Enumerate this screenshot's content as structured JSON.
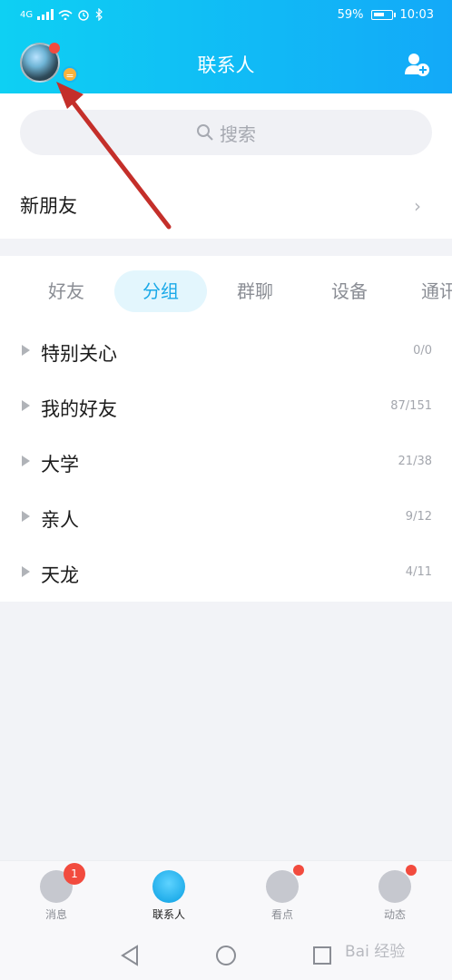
{
  "status_bar": {
    "signal": "4G",
    "battery_percent": "59%",
    "time": "10:03"
  },
  "header": {
    "title": "联系人",
    "avatar_badge": "="
  },
  "search": {
    "placeholder": "搜索"
  },
  "new_friends": {
    "label": "新朋友"
  },
  "tabs": [
    {
      "label": "好友",
      "active": false
    },
    {
      "label": "分组",
      "active": true
    },
    {
      "label": "群聊",
      "active": false
    },
    {
      "label": "设备",
      "active": false
    },
    {
      "label": "通讯",
      "active": false
    }
  ],
  "groups": [
    {
      "name": "特别关心",
      "count": "0/0"
    },
    {
      "name": "我的好友",
      "count": "87/151"
    },
    {
      "name": "大学",
      "count": "21/38"
    },
    {
      "name": "亲人",
      "count": "9/12"
    },
    {
      "name": "天龙",
      "count": "4/11"
    }
  ],
  "bottom_nav": [
    {
      "label": "消息",
      "badge": "1",
      "icon": "message-icon"
    },
    {
      "label": "联系人",
      "icon": "contacts-icon",
      "active": true
    },
    {
      "label": "看点",
      "icon": "eye-icon"
    },
    {
      "label": "动态",
      "icon": "planet-icon"
    }
  ],
  "watermark": "Bai 经验",
  "colors": {
    "header_gradient_start": "#0ed0f3",
    "header_gradient_end": "#13a9f8",
    "accent": "#1aa9e8",
    "badge_red": "#f24b3e"
  }
}
